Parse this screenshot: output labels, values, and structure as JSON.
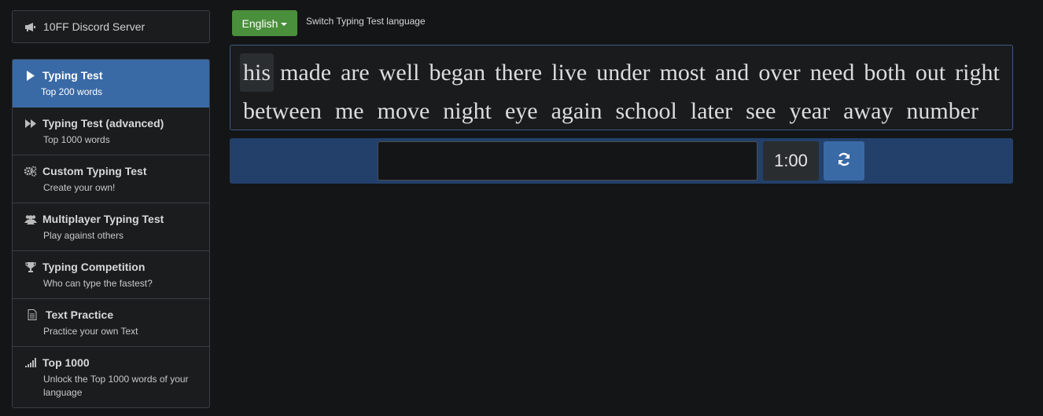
{
  "sidebar": {
    "discord": {
      "label": "10FF Discord Server",
      "icon": "megaphone-icon"
    },
    "items": [
      {
        "title": "Typing Test",
        "subtitle": "Top 200 words",
        "icon": "play-icon",
        "active": true
      },
      {
        "title": "Typing Test (advanced)",
        "subtitle": "Top 1000 words",
        "icon": "fast-forward-icon",
        "active": false
      },
      {
        "title": "Custom Typing Test",
        "subtitle": "Create your own!",
        "icon": "gears-icon",
        "active": false
      },
      {
        "title": "Multiplayer Typing Test",
        "subtitle": "Play against others",
        "icon": "users-icon",
        "active": false
      },
      {
        "title": "Typing Competition",
        "subtitle": "Who can type the fastest?",
        "icon": "trophy-icon",
        "active": false
      },
      {
        "title": "Text Practice",
        "subtitle": "Practice your own Text",
        "icon": "document-icon",
        "active": false
      },
      {
        "title": "Top 1000",
        "subtitle": "Unlock the Top 1000 words of your language",
        "icon": "signal-bars-icon",
        "active": false
      }
    ]
  },
  "language": {
    "selected": "English",
    "hint": "Switch Typing Test language"
  },
  "words": {
    "line1": [
      "his",
      "made",
      "are",
      "well",
      "began",
      "there",
      "live",
      "under",
      "most",
      "and",
      "over",
      "need",
      "both",
      "out",
      "right"
    ],
    "line2": [
      "between",
      "me",
      "move",
      "night",
      "eye",
      "again",
      "school",
      "later",
      "see",
      "year",
      "away",
      "number"
    ],
    "current_index": 0
  },
  "input": {
    "value": "",
    "placeholder": ""
  },
  "timer": {
    "value": "1:00"
  },
  "colors": {
    "background": "#141517",
    "active_item": "#3a6aa6",
    "language_button": "#4a8f3c",
    "input_bar": "#22406a"
  }
}
